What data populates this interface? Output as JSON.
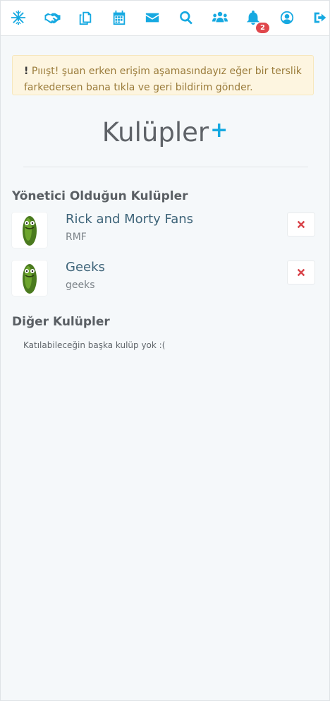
{
  "nav": {
    "icons": [
      "snowflake-icon",
      "handshake-icon",
      "copy-icon",
      "calendar-icon",
      "envelope-icon",
      "search-icon",
      "users-icon",
      "bell-icon",
      "user-circle-icon",
      "sign-out-icon"
    ],
    "notification_count": "2",
    "accent_color": "#16a9e1"
  },
  "alert": {
    "bang": "!",
    "text": "Pııışt! şuan erken erişim aşamasındayız eğer bir terslik farkedersen bana tıkla ve geri bildirim gönder."
  },
  "page": {
    "title": "Kulüpler",
    "add_symbol": "+"
  },
  "admin_section": {
    "title": "Yönetici Olduğun Kulüpler",
    "clubs": [
      {
        "name": "Rick and Morty Fans",
        "short": "RMF"
      },
      {
        "name": "Geeks",
        "short": "geeks"
      }
    ]
  },
  "other_section": {
    "title": "Diğer Kulüpler",
    "empty_message": "Katılabileceğin başka kulüp yok :("
  }
}
